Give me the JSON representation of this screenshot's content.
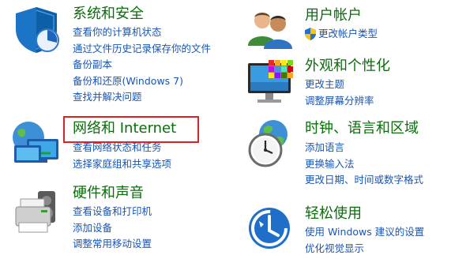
{
  "categories": {
    "system_security": {
      "title": "系统和安全",
      "links": [
        "查看你的计算机状态",
        "通过文件历史记录保存你的文件",
        "备份副本",
        "备份和还原(Windows 7)",
        "查找并解决问题"
      ]
    },
    "network": {
      "title": "网络和 Internet",
      "links": [
        "查看网络状态和任务",
        "选择家庭组和共享选项"
      ]
    },
    "hardware_sound": {
      "title": "硬件和声音",
      "links": [
        "查看设备和打印机",
        "添加设备",
        "调整常用移动设置"
      ]
    },
    "user_accounts": {
      "title": "用户帐户",
      "links": [
        "更改帐户类型"
      ]
    },
    "appearance": {
      "title": "外观和个性化",
      "links": [
        "更改主题",
        "调整屏幕分辨率"
      ]
    },
    "clock_language": {
      "title": "时钟、语言和区域",
      "links": [
        "添加语言",
        "更换输入法",
        "更改日期、时间或数字格式"
      ]
    },
    "ease_of_access": {
      "title": "轻松使用",
      "links": [
        "使用 Windows 建议的设置",
        "优化视觉显示"
      ]
    }
  },
  "colors": {
    "title_green": "#0a6e0a",
    "link_blue": "#1a55b0",
    "highlight_red": "#e02020"
  },
  "icons": {
    "system_security": "shield-icon",
    "network": "globe-network-icon",
    "hardware_sound": "printer-speaker-icon",
    "user_accounts": "users-icon",
    "appearance": "monitor-colors-icon",
    "clock_language": "clock-globe-icon",
    "ease_of_access": "ease-of-access-icon",
    "uac": "uac-shield-icon"
  }
}
